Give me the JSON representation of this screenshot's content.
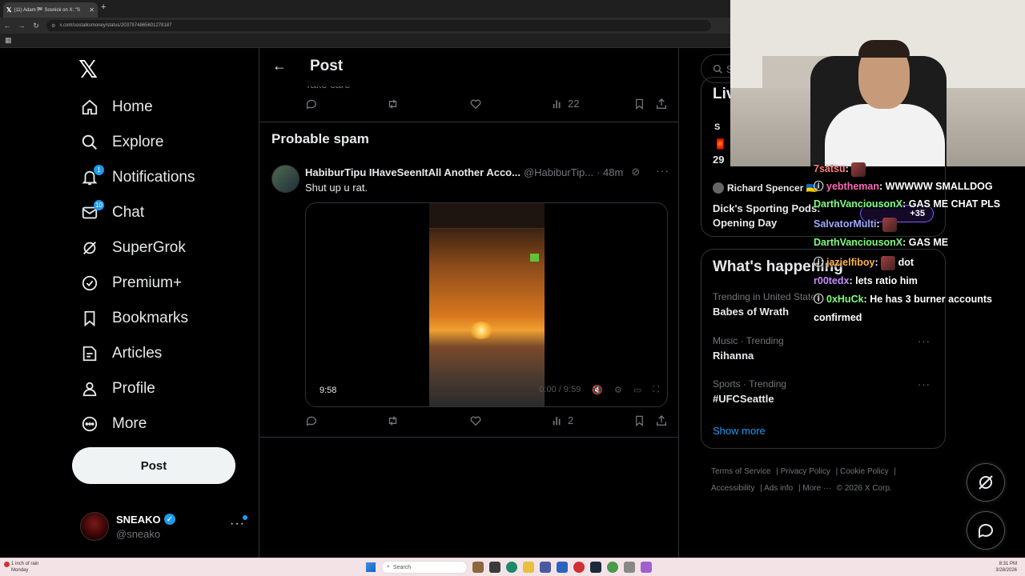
{
  "browser": {
    "tab_title": "(11) Adam 🏁 Sosnick on X: \"S",
    "url": "x.com/sostalksmoney/status/2037974865601278187"
  },
  "nav": {
    "items": [
      {
        "label": "Home",
        "icon": "home-icon"
      },
      {
        "label": "Explore",
        "icon": "search-icon"
      },
      {
        "label": "Notifications",
        "icon": "bell-icon",
        "badge": "1"
      },
      {
        "label": "Chat",
        "icon": "mail-icon",
        "badge": "10"
      },
      {
        "label": "SuperGrok",
        "icon": "grok-icon"
      },
      {
        "label": "Premium+",
        "icon": "verified-badge-icon"
      },
      {
        "label": "Bookmarks",
        "icon": "bookmark-icon"
      },
      {
        "label": "Articles",
        "icon": "article-icon"
      },
      {
        "label": "Profile",
        "icon": "person-icon"
      },
      {
        "label": "More",
        "icon": "more-circle-icon"
      }
    ],
    "post_label": "Post",
    "account": {
      "name": "SNEAKO",
      "handle": "@sneako"
    }
  },
  "main": {
    "header_title": "Post",
    "cut_text": "Take care",
    "prev_actions": {
      "views": "22"
    },
    "section_title": "Probable spam",
    "tweet": {
      "name": "HabiburTipu IHaveSeenItAll Another Acco...",
      "handle": "@HabiburTip...",
      "time": "· 48m",
      "text": "Shut up u rat.",
      "video_duration": "9:58",
      "video_progress": "0:00 / 9:59",
      "views": "2"
    }
  },
  "right": {
    "search_placeholder": "S",
    "live": {
      "title": "Liv",
      "host1": "S",
      "num": "29",
      "host2": "Richard Spencer 🇺🇦",
      "event": "Dick's Sporting Pods: Opening Day"
    },
    "happening": {
      "title": "What's happening",
      "trends": [
        {
          "category": "Trending in United States",
          "name": "Babes of Wrath"
        },
        {
          "category": "Music · Trending",
          "name": "Rihanna"
        },
        {
          "category": "Sports · Trending",
          "name": "#UFCSeattle"
        }
      ],
      "show_more": "Show more"
    },
    "footer": {
      "links": [
        "Terms of Service",
        "Privacy Policy",
        "Cookie Policy",
        "Accessibility",
        "Ads info",
        "More ···",
        "© 2026 X Corp."
      ]
    }
  },
  "chat": {
    "plus_count": "+35",
    "messages": [
      {
        "user": "7satsu",
        "text": "",
        "color": "#ff7d7d"
      },
      {
        "user": "yebtheman",
        "text": "WWWWW SMALLDOG",
        "color": "#ff69b4"
      },
      {
        "user": "DarthVanciousonX",
        "text": "GAS ME CHAT PLS",
        "color": "#7dff7d"
      },
      {
        "user": "SalvatorMulti",
        "text": "",
        "color": "#9fa8ff"
      },
      {
        "user": "DarthVanciousonX",
        "text": "GAS ME",
        "color": "#7dff7d"
      },
      {
        "user": "jazielfiboy",
        "text": "dot",
        "color": "#ffb347"
      },
      {
        "user": "r00tedx",
        "text": "lets ratio him",
        "color": "#c58cff"
      },
      {
        "user": "0xHuCk",
        "text": "He has 3 burner accounts",
        "color": "#7dff7d"
      },
      {
        "user": "",
        "text": "confirmed",
        "color": "#ffffff"
      }
    ]
  },
  "taskbar": {
    "weather_line1": "1 inch of rain",
    "weather_line2": "Monday",
    "search": "Search",
    "time": "8:31 PM",
    "date": "3/28/2026"
  },
  "colors": {
    "accent": "#1d9bf0",
    "border": "#2f3336",
    "muted": "#71767b"
  }
}
